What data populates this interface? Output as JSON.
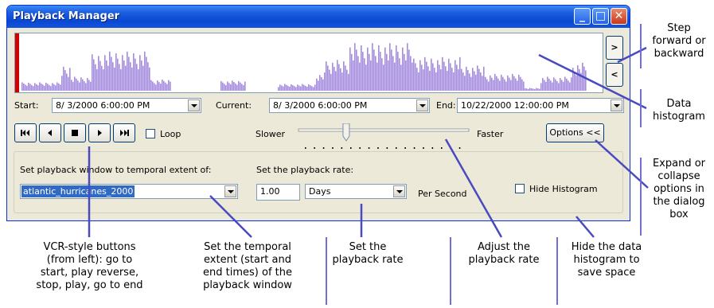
{
  "window": {
    "title": "Playback Manager",
    "buttons": {
      "minimize": "_",
      "maximize": "□",
      "close": "✕"
    }
  },
  "step_buttons": {
    "forward": ">",
    "backward": "<"
  },
  "time_fields": {
    "start_label": "Start:",
    "start_value": "8/ 3/2000  6:00:00 PM",
    "current_label": "Current:",
    "current_value": "8/ 3/2000  6:00:00 PM",
    "end_label": "End:",
    "end_value": "10/22/2000 12:00:00 PM"
  },
  "vcr": {
    "loop_label": "Loop"
  },
  "rate_slider": {
    "slower_label": "Slower",
    "faster_label": "Faster",
    "position": 0.28
  },
  "options_button": "Options <<",
  "options_panel": {
    "window_label": "Set playback window to temporal extent of:",
    "window_value": "atlantic_hurricanes_2000",
    "rate_label": "Set the playback rate:",
    "rate_value": "1.00",
    "rate_unit": "Days",
    "per_second": "Per Second",
    "hide_histogram_label": "Hide Histogram"
  },
  "annotations": {
    "step": "Step\nforward or\nbackward",
    "histogram": "Data\nhistogram",
    "expand": "Expand or\ncollapse\noptions in\nthe dialog\nbox",
    "vcr": "VCR-style buttons\n(from left): go to\nstart, play reverse,\nstop, play, go to end",
    "extent": "Set the temporal\nextent (start and\nend times) of the\nplayback window",
    "set_rate": "Set the\nplayback rate",
    "adjust_rate": "Adjust the\nplayback rate",
    "hide": "Hide the data\nhistogram to\nsave space"
  },
  "colors": {
    "histogram": "#a58be0",
    "annotation_line": "#4a4ac0",
    "title_bar": "#0a48d2"
  }
}
